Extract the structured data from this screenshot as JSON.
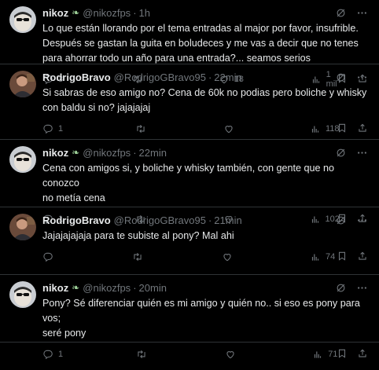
{
  "tweets": [
    {
      "name": "nikoz",
      "has_leaf": true,
      "handle": "@nikozfps",
      "time": "1h",
      "lines": [
        "Lo que están llorando por el tema entradas al major por favor, insufrible.",
        "Después se gastan la guita en boludeces y me vas a decir que no tenes",
        "para ahorrar todo un año para una entrada?... seamos serios"
      ],
      "replies": "3",
      "retweets": "",
      "likes": "18",
      "views": "1 mil",
      "avatar": "nikoz"
    },
    {
      "name": "RodrigoBravo",
      "has_leaf": false,
      "handle": "@RodrigoGBravo95",
      "time": "22min",
      "lines": [
        "Si sabras de eso amigo no? Cena de 60k no podias pero boliche y whisky",
        "con baldu si no? jajajajaj"
      ],
      "replies": "1",
      "retweets": "",
      "likes": "",
      "views": "118",
      "avatar": "rodrigo"
    },
    {
      "name": "nikoz",
      "has_leaf": true,
      "handle": "@nikozfps",
      "time": "22min",
      "lines": [
        "Cena con amigos si, y boliche y whisky también, con gente que no conozco",
        "no metía cena"
      ],
      "replies": "1",
      "retweets": "",
      "likes": "",
      "views": "102",
      "avatar": "nikoz"
    },
    {
      "name": "RodrigoBravo",
      "has_leaf": false,
      "handle": "@RodrigoGBravo95",
      "time": "21min",
      "lines": [
        "Jajajajajaja para te subiste al pony? Mal ahi"
      ],
      "replies": "",
      "retweets": "",
      "likes": "",
      "views": "74",
      "avatar": "rodrigo"
    },
    {
      "name": "nikoz",
      "has_leaf": true,
      "handle": "@nikozfps",
      "time": "20min",
      "lines": [
        "Pony? Sé diferenciar quién es mi amigo y quién no.. si eso es pony para vos;",
        "seré pony"
      ],
      "replies": "1",
      "retweets": "",
      "likes": "",
      "views": "71",
      "avatar": "nikoz"
    }
  ],
  "colors": {
    "background": "#000000",
    "text": "#e7e9ea",
    "muted": "#71767b",
    "divider": "#2f3336"
  },
  "icons": [
    "leaf-icon",
    "grok-icon",
    "more-icon",
    "reply-icon",
    "retweet-icon",
    "like-icon",
    "views-icon",
    "bookmark-icon",
    "share-icon"
  ]
}
